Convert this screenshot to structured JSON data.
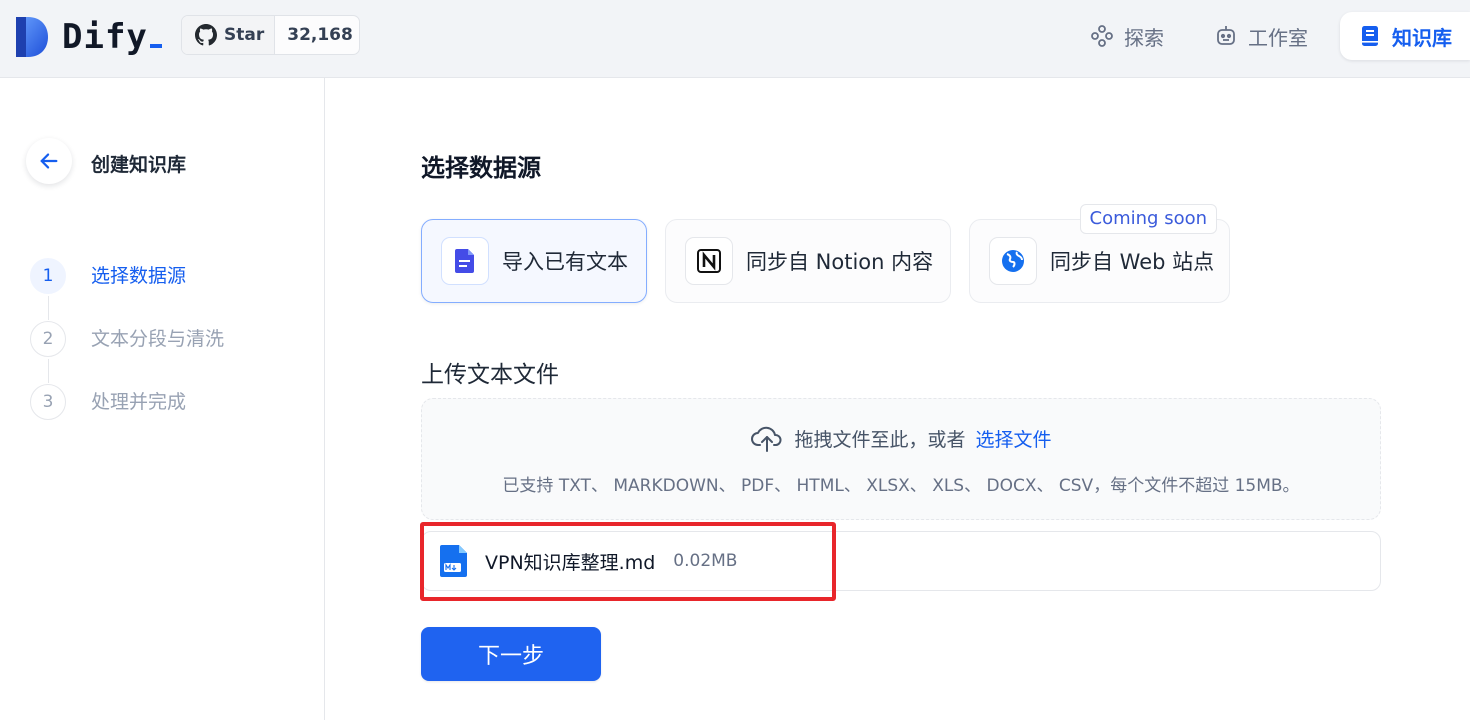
{
  "header": {
    "logo_text": "Dify",
    "github": {
      "star_label": "Star",
      "star_count": "32,168"
    },
    "nav": [
      {
        "label": "探索",
        "icon": "explore-icon"
      },
      {
        "label": "工作室",
        "icon": "robot-icon"
      },
      {
        "label": "知识库",
        "icon": "book-icon",
        "active": true
      }
    ]
  },
  "sidebar": {
    "title": "创建知识库",
    "steps": [
      {
        "num": "1",
        "label": "选择数据源",
        "active": true
      },
      {
        "num": "2",
        "label": "文本分段与清洗",
        "active": false
      },
      {
        "num": "3",
        "label": "处理并完成",
        "active": false
      }
    ]
  },
  "main": {
    "title": "选择数据源",
    "sources": [
      {
        "label": "导入已有文本",
        "icon": "document-icon",
        "active": true
      },
      {
        "label": "同步自 Notion 内容",
        "icon": "notion-icon",
        "active": false
      },
      {
        "label": "同步自 Web 站点",
        "icon": "globe-icon",
        "active": false,
        "badge": "Coming soon"
      }
    ],
    "upload": {
      "title": "上传文本文件",
      "drop_text": "拖拽文件至此，或者",
      "select_link": "选择文件",
      "support_text": "已支持 TXT、 MARKDOWN、 PDF、 HTML、 XLSX、 XLS、 DOCX、 CSV，每个文件不超过 15MB。"
    },
    "file": {
      "name": "VPN知识库整理.md",
      "size": "0.02MB",
      "icon": "markdown-file-icon"
    },
    "next_button": "下一步"
  },
  "colors": {
    "accent": "#155eef",
    "highlight": "#e8262b"
  }
}
